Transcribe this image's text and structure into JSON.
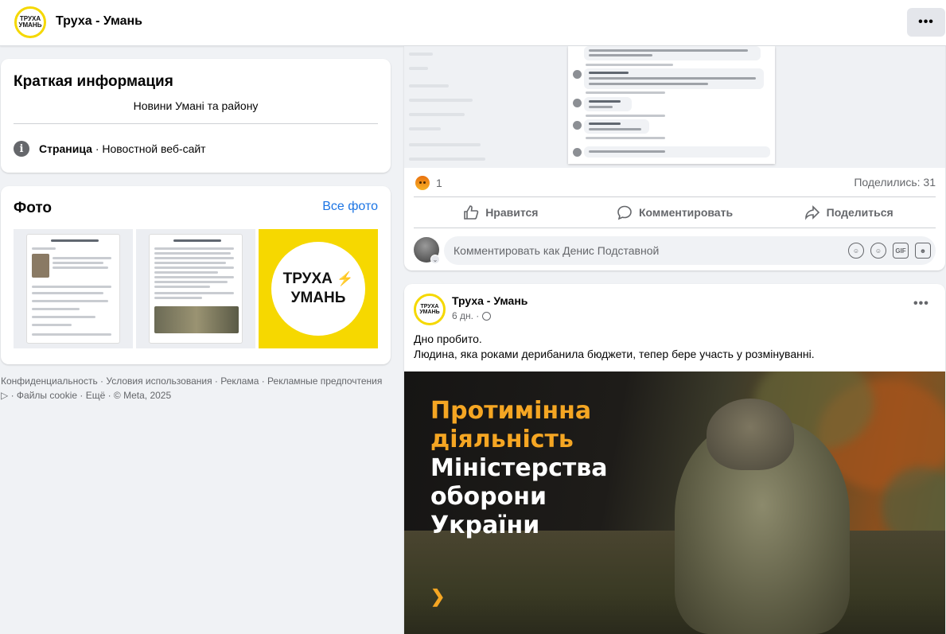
{
  "header": {
    "page_name": "Труха - Умань",
    "logo_top": "ТРУХА",
    "logo_bottom": "УМАНЬ",
    "more_label": "•••"
  },
  "intro": {
    "title": "Краткая информация",
    "description": "Новини Умані та району",
    "category_label": "Страница",
    "category_value": " · Новостной веб-сайт"
  },
  "photos": {
    "title": "Фото",
    "see_all": "Все фото",
    "logo_line1": "ТРУХА",
    "logo_bolt": "⚡",
    "logo_line2": "УМАНЬ"
  },
  "footer": {
    "text": "Конфиденциальность · Условия использования · Реклама · Рекламные предпочтения ▷ · Файлы cookie · Ещё · © Meta, 2025"
  },
  "post1": {
    "reaction_count": "1",
    "shares": "Поделились: 31",
    "actions": {
      "like": "Нравится",
      "comment": "Комментировать",
      "share": "Поделиться"
    },
    "comment_placeholder": "Комментировать как Денис Подставной",
    "comment_icons": {
      "avatar_sticker": "avatar-sticker-icon",
      "emoji": "emoji-icon",
      "gif": "GIF",
      "sticker": "sticker-icon"
    }
  },
  "post2": {
    "author": "Труха - Умань",
    "time": "6 дн. ·",
    "more_label": "•••",
    "text_line1": "Дно пробито.",
    "text_line2": "Людина, яка роками дерибанила бюджети, тепер бере участь у розмінуванні.",
    "image_headline": {
      "line1": "Протимінна",
      "line2": "діяльність",
      "line3": "Міністерства",
      "line4": "оборони",
      "line5": "України"
    },
    "image_chevron": "❯"
  },
  "colors": {
    "accent": "#1b74e4",
    "brand_yellow": "#f6d800",
    "headline_orange": "#f5a623",
    "background": "#f0f2f5"
  }
}
